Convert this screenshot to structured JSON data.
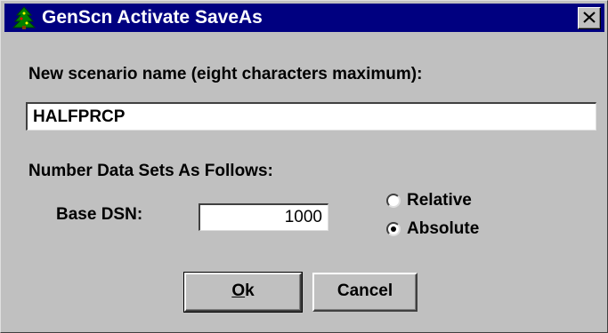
{
  "window": {
    "title": "GenScn Activate SaveAs",
    "app_icon": "tree-icon",
    "close_icon": "close-icon"
  },
  "scenario": {
    "label": "New scenario name (eight characters maximum):",
    "value": "HALFPRCP"
  },
  "numbering": {
    "label": "Number Data Sets As Follows:",
    "base_dsn_label": "Base DSN:",
    "base_dsn_value": "1000",
    "options": [
      {
        "label": "Relative",
        "selected": false
      },
      {
        "label": "Absolute",
        "selected": true
      }
    ]
  },
  "buttons": {
    "ok_mnemonic": "O",
    "ok_rest": "k",
    "cancel": "Cancel"
  }
}
